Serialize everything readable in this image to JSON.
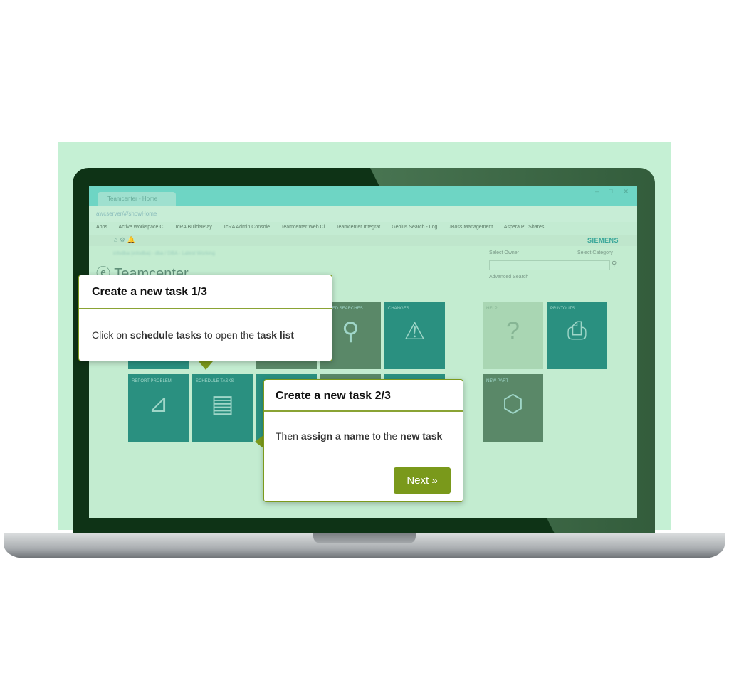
{
  "browser": {
    "tab_title": "Teamcenter - Home",
    "url": "awcserver/#/showHome",
    "window_controls": "– □ ✕",
    "bookmarks": [
      "Apps",
      "Active Workspace C",
      "TcRA BuildNPlay",
      "TcRA Admin Console",
      "Teamcenter Web Cl",
      "Teamcenter Integrat",
      "Geolus Search - Log",
      "JBoss Management",
      "Aspera PL Shares"
    ]
  },
  "app": {
    "brand": "SIEMENS",
    "logo_text": "Teamcenter",
    "blurred_header": "infodba (infodba) - dba / DBA - Latest Working",
    "toolbar_icons": "⌂ ⚙ 🔔",
    "select_owner": "Select Owner",
    "select_category": "Select Category",
    "advanced_search": "Advanced Search"
  },
  "tiles": [
    {
      "label": "",
      "icon": "folder-icon",
      "glyph": "▭"
    },
    {
      "label": "",
      "icon": "blank-icon",
      "glyph": ""
    },
    {
      "label": "Saved Searches",
      "icon": "magnifier-icon",
      "glyph": "⚲"
    },
    {
      "label": "Changes",
      "icon": "warning-icon",
      "glyph": "⚠"
    },
    {
      "label": "Help",
      "icon": "question-icon",
      "glyph": "?"
    },
    {
      "label": "Printouts",
      "icon": "printer-icon",
      "glyph": "⎙"
    },
    {
      "label": "Report Problem",
      "icon": "report-problem-icon",
      "glyph": "⊿"
    },
    {
      "label": "Schedule Tasks",
      "icon": "schedule-icon",
      "glyph": "▤"
    },
    {
      "label": "",
      "icon": "blank-icon",
      "glyph": ""
    },
    {
      "label": "",
      "icon": "blank-icon",
      "glyph": ""
    },
    {
      "label": "",
      "icon": "blank-icon",
      "glyph": ""
    },
    {
      "label": "New Part",
      "icon": "cube-icon",
      "glyph": "⬡"
    }
  ],
  "tooltip1": {
    "title": "Create a new task 1/3",
    "text_1": "Click on ",
    "bold_1": "schedule tasks",
    "text_2": " to open the ",
    "bold_2": "task list"
  },
  "tooltip2": {
    "title": "Create a new task 2/3",
    "text_1": "Then ",
    "bold_1": "assign a name",
    "text_2": " to the ",
    "bold_2": "new task",
    "next_label": "Next »"
  },
  "colors": {
    "accent": "#7a991b",
    "tile_teal": "#2a9080",
    "tile_green": "#5a8868",
    "background_panel": "#c5f0d4"
  }
}
